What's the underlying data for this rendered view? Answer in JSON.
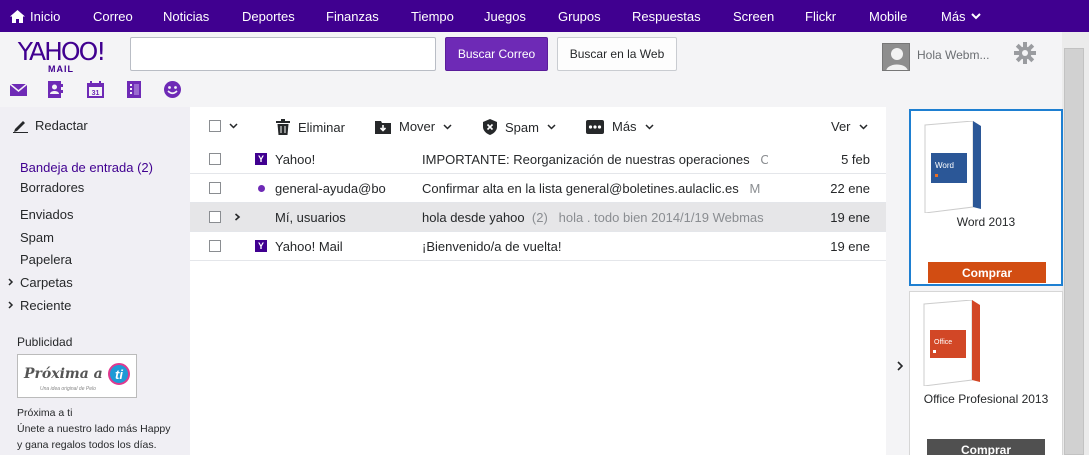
{
  "topnav": {
    "items": [
      "Inicio",
      "Correo",
      "Noticias",
      "Deportes",
      "Finanzas",
      "Tiempo",
      "Juegos",
      "Grupos",
      "Respuestas",
      "Screen",
      "Flickr",
      "Mobile",
      "Más"
    ]
  },
  "header": {
    "logo_text": "YAHOO!",
    "logo_sub": "MAIL",
    "search_value": "",
    "search_mail_label": "Buscar Correo",
    "search_web_label": "Buscar en la Web",
    "user_label": "Hola Webm..."
  },
  "sidebar": {
    "compose_label": "Redactar",
    "folders": [
      "Bandeja de entrada (2)",
      "Borradores",
      "Enviados",
      "Spam",
      "Papelera"
    ],
    "expandables": [
      "Carpetas",
      "Reciente"
    ],
    "ad_title": "Publicidad",
    "ad_logo_text": "Próxima a",
    "ad_logo_ti": "ti",
    "ad_logo_tag": "Una idea original de Pelo",
    "ad_lines": [
      "Próxima a ti",
      "Únete a nuestro lado más Happy",
      "y gana regalos todos los días."
    ]
  },
  "toolbar": {
    "delete_label": "Eliminar",
    "move_label": "Mover",
    "spam_label": "Spam",
    "more_label": "Más",
    "view_label": "Ver"
  },
  "messages": [
    {
      "from": "Yahoo!",
      "subject": "IMPORTANTE: Reorganización de nuestras operaciones",
      "snippet": "C",
      "date": "5 feb",
      "icon": "yahoo-icon",
      "selected": false
    },
    {
      "from": "general-ayuda@bo",
      "subject": "Confirmar alta en la lista general@boletines.aulaclic.es",
      "snippet": "M",
      "date": "22 ene",
      "icon": "unread-dot",
      "selected": false
    },
    {
      "from": "Mí, usuarios",
      "subject": "hola desde yahoo",
      "count": "(2)",
      "snippet": "hola . todo bien 2014/1/19 Webmas",
      "date": "19 ene",
      "icon": "expand",
      "selected": true
    },
    {
      "from": "Yahoo! Mail",
      "subject": "¡Bienvenido/a de vuelta!",
      "snippet": "",
      "date": "19 ene",
      "icon": "yahoo-icon",
      "selected": false
    }
  ],
  "ads": [
    {
      "product_box": "Word",
      "title": "Word 2013",
      "button": "Comprar",
      "button_color": "#d24d12"
    },
    {
      "product_box": "Office",
      "title": "Office Profesional 2013",
      "button": "Comprar",
      "button_color": "#505050"
    }
  ],
  "colors": {
    "brand": "#400090",
    "accent": "#6e2ab6"
  }
}
